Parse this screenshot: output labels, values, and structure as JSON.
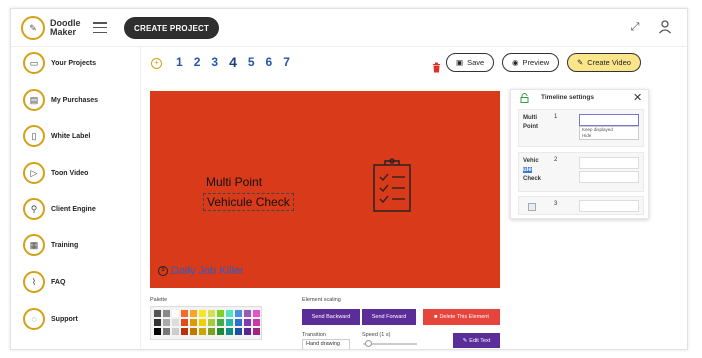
{
  "header": {
    "logo_line1": "Doodle",
    "logo_line2": "Maker",
    "create_project": "CREATE PROJECT"
  },
  "sidebar": {
    "items": [
      {
        "label": "Your Projects",
        "icon": "projects-icon"
      },
      {
        "label": "My Purchases",
        "icon": "cart-icon"
      },
      {
        "label": "White Label",
        "icon": "document-icon"
      },
      {
        "label": "Toon Video",
        "icon": "video-icon"
      },
      {
        "label": "Client Engine",
        "icon": "search-icon"
      },
      {
        "label": "Training",
        "icon": "training-icon"
      },
      {
        "label": "FAQ",
        "icon": "paperclip-icon"
      },
      {
        "label": "Support",
        "icon": "chat-icon"
      }
    ]
  },
  "toolbar": {
    "add_slide": "+",
    "slides": [
      "1",
      "2",
      "3",
      "4",
      "5",
      "6",
      "7"
    ],
    "active_slide": "4",
    "save": "Save",
    "preview": "Preview",
    "create_video": "Create Video"
  },
  "canvas": {
    "background": "#d83a1a",
    "text_line1": "Multi Point",
    "text_line2": "Vehicule Check",
    "brand_text": "Daily Job Killer"
  },
  "bottom": {
    "palette_label": "Palette",
    "palette_colors": [
      "#555555",
      "#888888",
      "#ffffff",
      "#f26b2a",
      "#f5a623",
      "#f8e71c",
      "#d4e157",
      "#7ed321",
      "#50e3c2",
      "#4a90e2",
      "#9b59b6",
      "#e056c9",
      "#333333",
      "#aaaaaa",
      "#dddddd",
      "#e04b1a",
      "#e09a00",
      "#f0d000",
      "#a8c93a",
      "#3fae49",
      "#26b5a8",
      "#2f6fd0",
      "#7d3cb5",
      "#c73aa8",
      "#000000",
      "#777777",
      "#cccccc",
      "#b83010",
      "#c07800",
      "#c8a800",
      "#7ea020",
      "#1f8a33",
      "#0f8e84",
      "#1d4fa5",
      "#5a2491",
      "#a0257f"
    ],
    "scaling_label": "Element scaling",
    "send_backward": "Send Backward",
    "send_forward": "Send Forward",
    "delete_element": "Delete This Element",
    "transition_label": "Transition",
    "transition_value": "Hand drawing",
    "speed_label": "Speed (1 s)",
    "edit_text": "Edit Text"
  },
  "timeline": {
    "title": "Timeline settings",
    "rows": [
      {
        "name": "Multi Point",
        "index": "1",
        "options": [
          "Keep displayed",
          "Hide"
        ]
      },
      {
        "name_parts": [
          "Vehic",
          "ule",
          "Check"
        ],
        "index": "2"
      },
      {
        "index": "3"
      }
    ]
  }
}
